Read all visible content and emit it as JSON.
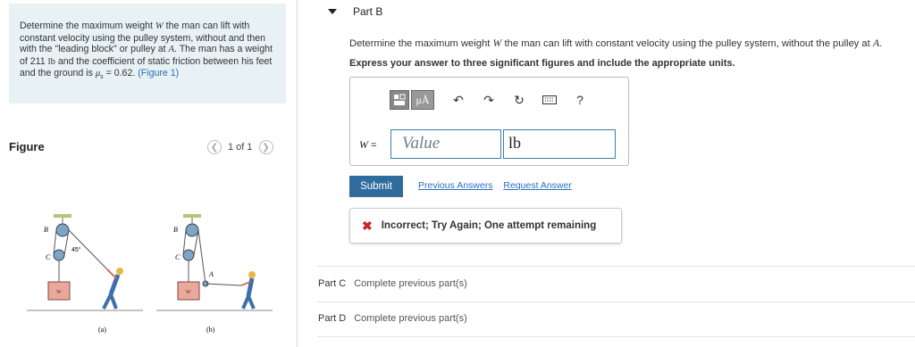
{
  "problem": {
    "text_before": "Determine the maximum weight ",
    "var_w": "W",
    "text_mid1": " the man can lift with constant velocity using the pulley system, without and then with the \"leading block\" or pulley at ",
    "var_a": "A",
    "text_mid2": ". The man has a weight of 211 ",
    "unit_lb": "lb",
    "text_mid3": " and the coefficient of static friction between his feet and the ground is ",
    "var_mu": "μ",
    "sub_s": "s",
    "text_end": " = 0.62. ",
    "fig_link": "(Figure 1)"
  },
  "figure_panel": {
    "title": "Figure",
    "pager_text": "1 of 1",
    "label_a": "(a)",
    "label_b": "(b)",
    "lbl_B": "B",
    "lbl_C": "C",
    "lbl_A": "A",
    "lbl_w": "W",
    "lbl_angle": "45°"
  },
  "part_b": {
    "header": "Part B",
    "question_before": "Determine the maximum weight ",
    "question_var": "W",
    "question_mid": " the man can lift with constant velocity using the pulley system, without the pulley at ",
    "question_var_a": "A",
    "question_end": ".",
    "instructions": "Express your answer to three significant figures and include the appropriate units.",
    "toolbar": {
      "units_label": "μÅ",
      "help_label": "?"
    },
    "answer": {
      "label_var": "W",
      "label_eq": " =",
      "value_placeholder": "Value",
      "unit_value": "lb"
    },
    "submit_label": "Submit",
    "previous_answers_label": "Previous Answers",
    "request_answer_label": "Request Answer",
    "feedback_text": "Incorrect; Try Again; One attempt remaining"
  },
  "other_parts": [
    {
      "label": "Part C",
      "status": "Complete previous part(s)"
    },
    {
      "label": "Part D",
      "status": "Complete previous part(s)"
    }
  ],
  "colors": {
    "problem_bg": "#e8f2f4",
    "submit_bg": "#2f6c9e",
    "link": "#2a6ebb",
    "incorrect": "#c62828"
  }
}
